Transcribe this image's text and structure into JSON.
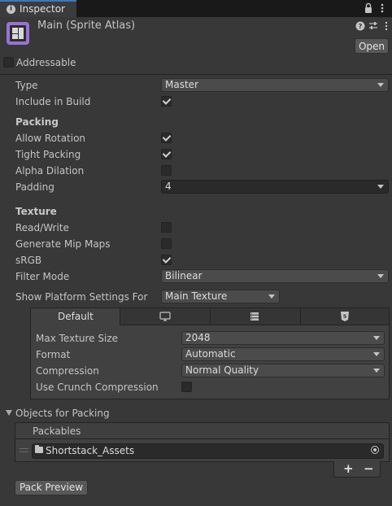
{
  "tab": {
    "label": "Inspector"
  },
  "header": {
    "title": "Main (Sprite Atlas)",
    "open_label": "Open"
  },
  "addressable": {
    "label": "Addressable",
    "checked": false
  },
  "type_field": {
    "label": "Type",
    "value": "Master"
  },
  "include_in_build": {
    "label": "Include in Build",
    "checked": true
  },
  "packing": {
    "heading": "Packing",
    "allow_rotation": {
      "label": "Allow Rotation",
      "checked": true
    },
    "tight_packing": {
      "label": "Tight Packing",
      "checked": true
    },
    "alpha_dilation": {
      "label": "Alpha Dilation",
      "checked": false
    },
    "padding": {
      "label": "Padding",
      "value": "4"
    }
  },
  "texture": {
    "heading": "Texture",
    "read_write": {
      "label": "Read/Write",
      "checked": false
    },
    "generate_mip_maps": {
      "label": "Generate Mip Maps",
      "checked": false
    },
    "srgb": {
      "label": "sRGB",
      "checked": true
    },
    "filter_mode": {
      "label": "Filter Mode",
      "value": "Bilinear"
    }
  },
  "platform": {
    "show_label": "Show Platform Settings For",
    "show_value": "Main Texture",
    "tabs": [
      {
        "label": "Default",
        "icon": ""
      },
      {
        "label": "",
        "icon": "monitor-icon"
      },
      {
        "label": "",
        "icon": "server-icon"
      },
      {
        "label": "",
        "icon": "html5-icon"
      }
    ],
    "max_texture_size": {
      "label": "Max Texture Size",
      "value": "2048"
    },
    "format": {
      "label": "Format",
      "value": "Automatic"
    },
    "compression": {
      "label": "Compression",
      "value": "Normal Quality"
    },
    "use_crunch": {
      "label": "Use Crunch Compression",
      "checked": false
    }
  },
  "objects": {
    "heading": "Objects for Packing",
    "list_header": "Packables",
    "items": [
      {
        "name": "Shortstack_Assets",
        "icon": "folder-icon"
      }
    ],
    "add_label": "+",
    "remove_label": "−"
  },
  "pack_preview_label": "Pack Preview",
  "colors": {
    "background": "#383838",
    "tab_accent": "#3a79bb",
    "field_bg": "#2a2a2a",
    "dropdown_bg": "#4b4b4b"
  }
}
